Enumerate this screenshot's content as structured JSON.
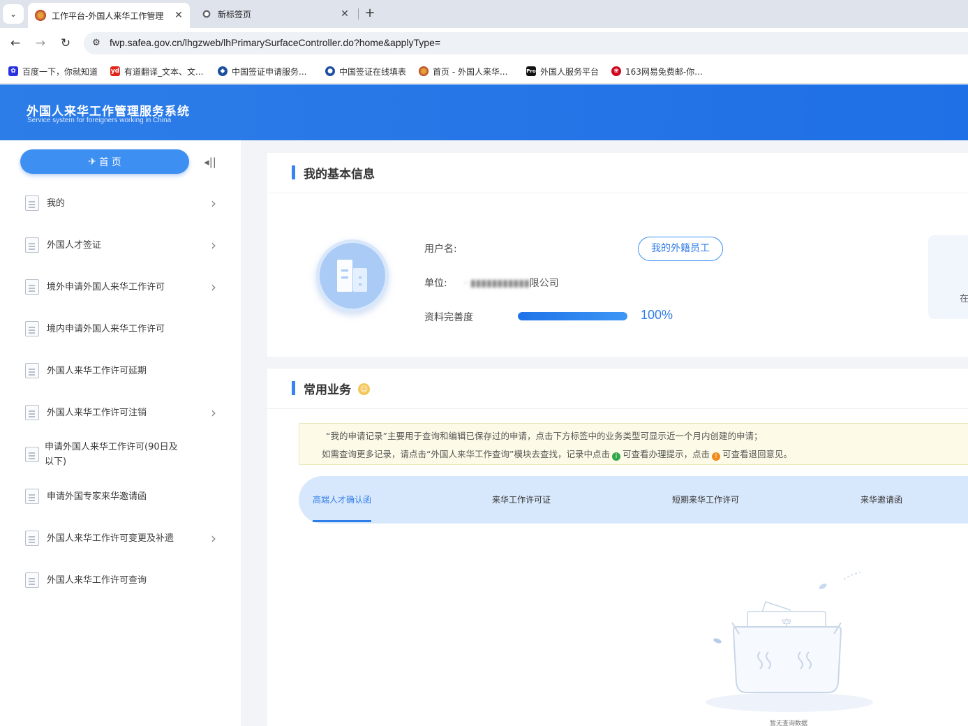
{
  "browser": {
    "tabs": [
      {
        "title": "工作平台-外国人来华工作管理",
        "active": true
      },
      {
        "title": "新标签页",
        "active": false
      }
    ],
    "url": "fwp.safea.gov.cn/lhgzweb/lhPrimarySurfaceController.do?home&applyType=",
    "bookmarks": [
      {
        "label": "百度一下，你就知道",
        "color": "#2932e1"
      },
      {
        "label": "有道翻译_文本、文...",
        "color": "#e1251b",
        "badge": "yd"
      },
      {
        "label": "中国签证申请服务...",
        "color": "#1d4fa0"
      },
      {
        "label": "中国签证在线填表",
        "color": "#1d4fa0"
      },
      {
        "label": "首页 - 外国人来华...",
        "color": "#b23a22"
      },
      {
        "label": "外国人服务平台",
        "color": "#111111",
        "badge": "Pro"
      },
      {
        "label": "163网易免费邮-你...",
        "color": "#d0021b"
      }
    ]
  },
  "app": {
    "title": "外国人来华工作管理服务系统",
    "subtitle": "Service system for foreigners working in China"
  },
  "sidebar": {
    "home_label": "首 页",
    "items": [
      {
        "label": "我的",
        "chevron": true
      },
      {
        "label": "外国人才签证",
        "chevron": true
      },
      {
        "label": "境外申请外国人来华工作许可",
        "chevron": true
      },
      {
        "label": "境内申请外国人来华工作许可",
        "chevron": false
      },
      {
        "label": "外国人来华工作许可延期",
        "chevron": false
      },
      {
        "label": "外国人来华工作许可注销",
        "chevron": true
      },
      {
        "label": "申请外国人来华工作许可(90日及以下)",
        "chevron": false
      },
      {
        "label": "申请外国专家来华邀请函",
        "chevron": false
      },
      {
        "label": "外国人来华工作许可变更及补遗",
        "chevron": true
      },
      {
        "label": "外国人来华工作许可查询",
        "chevron": false
      }
    ]
  },
  "basic_info": {
    "heading": "我的基本信息",
    "username_label": "用户名:",
    "username_value": "",
    "unit_label": "单位:",
    "unit_value": "限公司",
    "staff_button": "我的外籍员工",
    "completeness_label": "资料完善度",
    "completeness_value": "100%",
    "completeness_fraction": 1.0,
    "side_panel_text": "在"
  },
  "business": {
    "heading": "常用业务",
    "notice_line1": "“我的申请记录”主要用于查询和编辑已保存过的申请，点击下方标签中的业务类型可显示近一个月内创建的申请；",
    "notice_line2_a": "如需查询更多记录，请点击“外国人来华工作查询”模块去查找，记录中点击",
    "notice_line2_b": "可查看办理提示，点击",
    "notice_line2_c": "可查看退回意见。",
    "tabs": [
      {
        "label": "高端人才确认函",
        "active": true
      },
      {
        "label": "来华工作许可证",
        "active": false
      },
      {
        "label": "短期来华工作许可",
        "active": false
      },
      {
        "label": "来华邀请函",
        "active": false
      }
    ],
    "empty_box_text": "空",
    "empty_caption": "暂无查询数据"
  }
}
